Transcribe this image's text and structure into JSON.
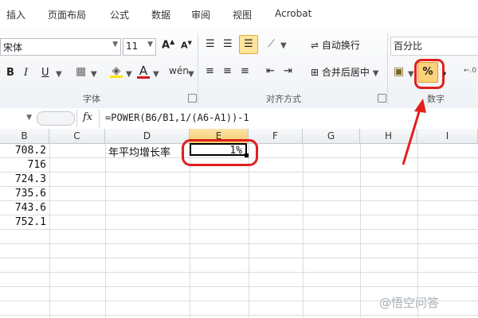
{
  "ribbon_tabs": [
    "插入",
    "页面布局",
    "公式",
    "数据",
    "审阅",
    "视图",
    "Acrobat"
  ],
  "font": {
    "name": "宋体",
    "size": "11",
    "group_label": "字体"
  },
  "alignment": {
    "wrap_text_label": "自动换行",
    "merge_center_label": "合并后居中",
    "group_label": "对齐方式"
  },
  "number": {
    "format": "百分比",
    "group_label": "数字",
    "percent_label": "%"
  },
  "formula_bar": {
    "fx_label": "fx",
    "formula": "=POWER(B6/B1,1/(A6-A1))-1"
  },
  "columns": [
    "B",
    "C",
    "D",
    "E",
    "F",
    "G",
    "H",
    "I"
  ],
  "cells": {
    "b_values": [
      "708.2",
      "716",
      "724.3",
      "735.6",
      "743.6",
      "752.1"
    ],
    "d1_label": "年平均增长率",
    "e1_value": "1%"
  },
  "watermark": "@悟空问答",
  "colors": {
    "highlight_red": "#e0201c",
    "active_orange": "#f5b54a",
    "selected_cell": "#000000"
  }
}
